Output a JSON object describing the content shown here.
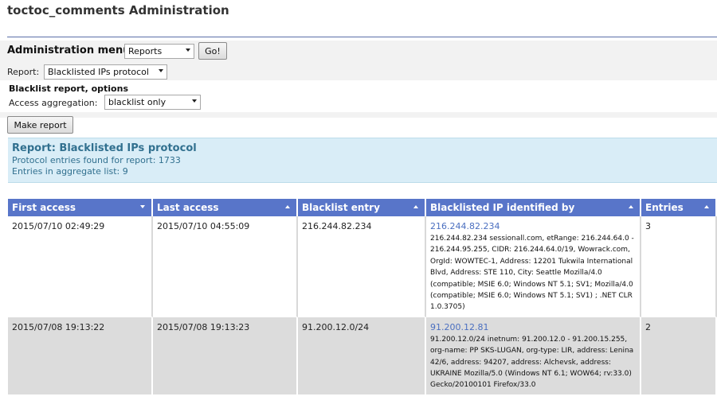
{
  "page": {
    "title": "toctoc_comments Administration"
  },
  "admin_menu": {
    "label": "Administration menu",
    "selected": "Reports",
    "go_label": "Go!"
  },
  "report_select": {
    "label": "Report:",
    "selected": "Blacklisted IPs protocol"
  },
  "options": {
    "title": "Blacklist report, options",
    "aggregation_label": "Access aggregation:",
    "aggregation_selected": "blacklist only"
  },
  "make_report_label": "Make report",
  "info": {
    "title": "Report: Blacklisted IPs protocol",
    "entries_found": "Protocol entries found for report: 1733",
    "aggregate_count": "Entries in aggregate list: 9"
  },
  "table": {
    "columns": [
      "First access",
      "Last access",
      "Blacklist entry",
      "Blacklisted IP identified by",
      "Entries"
    ],
    "rows": [
      {
        "first_access": "2015/07/10 02:49:29",
        "last_access": "2015/07/10 04:55:09",
        "blacklist_entry": "216.244.82.234",
        "ip": "216.244.82.234",
        "detail": "216.244.82.234 sessionall.com, etRange: 216.244.64.0 - 216.244.95.255, CIDR: 216.244.64.0/19, Wowrack.com, OrgId: WOWTEC-1, Address: 12201 Tukwila International Blvd, Address: STE 110, City: Seattle Mozilla/4.0 (compatible; MSIE 6.0; Windows NT 5.1; SV1; Mozilla/4.0 (compatible; MSIE 6.0; Windows NT 5.1; SV1) ; .NET CLR 1.0.3705)",
        "entries": "3"
      },
      {
        "first_access": "2015/07/08 19:13:22",
        "last_access": "2015/07/08 19:13:23",
        "blacklist_entry": "91.200.12.0/24",
        "ip": "91.200.12.81",
        "detail": "91.200.12.0/24 inetnum: 91.200.12.0 - 91.200.15.255, org-name: PP SKS-LUGAN, org-type: LIR, address: Lenina 42/6, address: 94207, address: Alchevsk, address: UKRAINE Mozilla/5.0 (Windows NT 6.1; WOW64; rv:33.0) Gecko/20100101 Firefox/33.0",
        "entries": "2"
      }
    ]
  }
}
